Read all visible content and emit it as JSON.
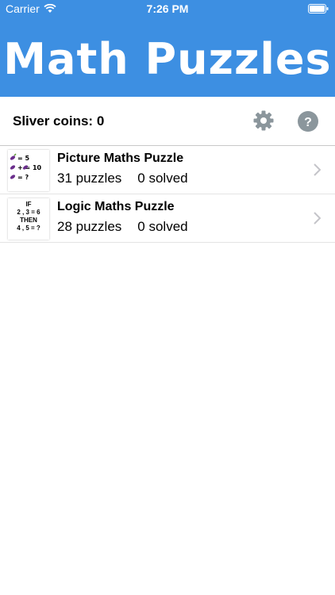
{
  "status_bar": {
    "carrier": "Carrier",
    "time": "7:26 PM"
  },
  "header": {
    "title": "Math Puzzles",
    "background_color": "#3d8fe2"
  },
  "coins": {
    "label": "Sliver coins: 0"
  },
  "toolbar": {
    "settings_icon": "gear-icon",
    "help_icon": "question-icon"
  },
  "puzzles": [
    {
      "title": "Picture Maths Puzzle",
      "count": "31 puzzles",
      "solved": "0 solved",
      "thumb_lines": [
        "= 5",
        "+ = 10",
        "= ?"
      ]
    },
    {
      "title": "Logic Maths Puzzle",
      "count": "28 puzzles",
      "solved": "0 solved",
      "thumb_lines": [
        "IF",
        "2 , 3 = 6",
        "THEN",
        "4 , 5 = ?"
      ]
    }
  ]
}
